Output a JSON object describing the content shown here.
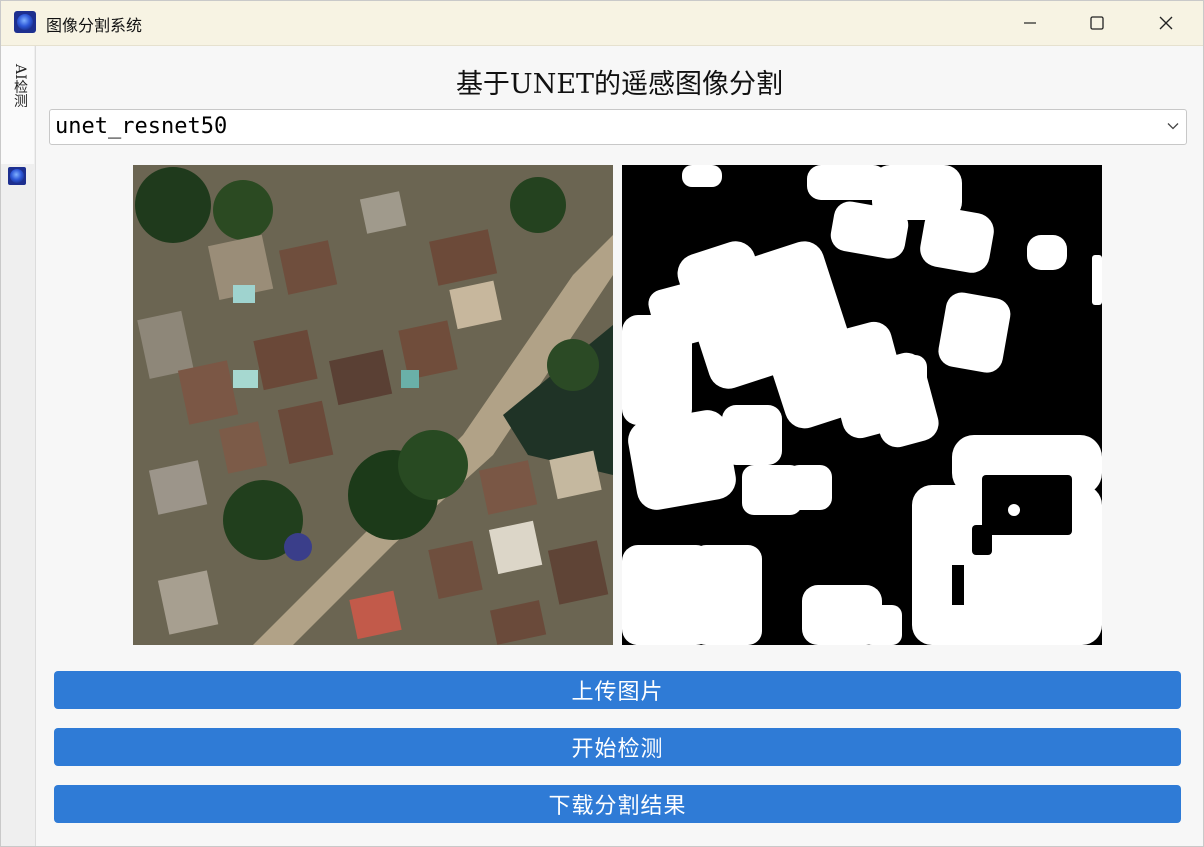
{
  "window": {
    "title": "图像分割系统"
  },
  "side_tab": {
    "label": "AI检测"
  },
  "main": {
    "heading": "基于UNET的遥感图像分割",
    "model_select": {
      "value": "unet_resnet50"
    },
    "images": {
      "original": "satellite-photo",
      "mask": "segmentation-mask"
    },
    "buttons": {
      "upload": "上传图片",
      "detect": "开始检测",
      "download": "下载分割结果"
    }
  },
  "colors": {
    "title_bar": "#f7f3e3",
    "button": "#2f7bd6",
    "button_text": "#ffffff",
    "background": "#f7f7f7"
  }
}
